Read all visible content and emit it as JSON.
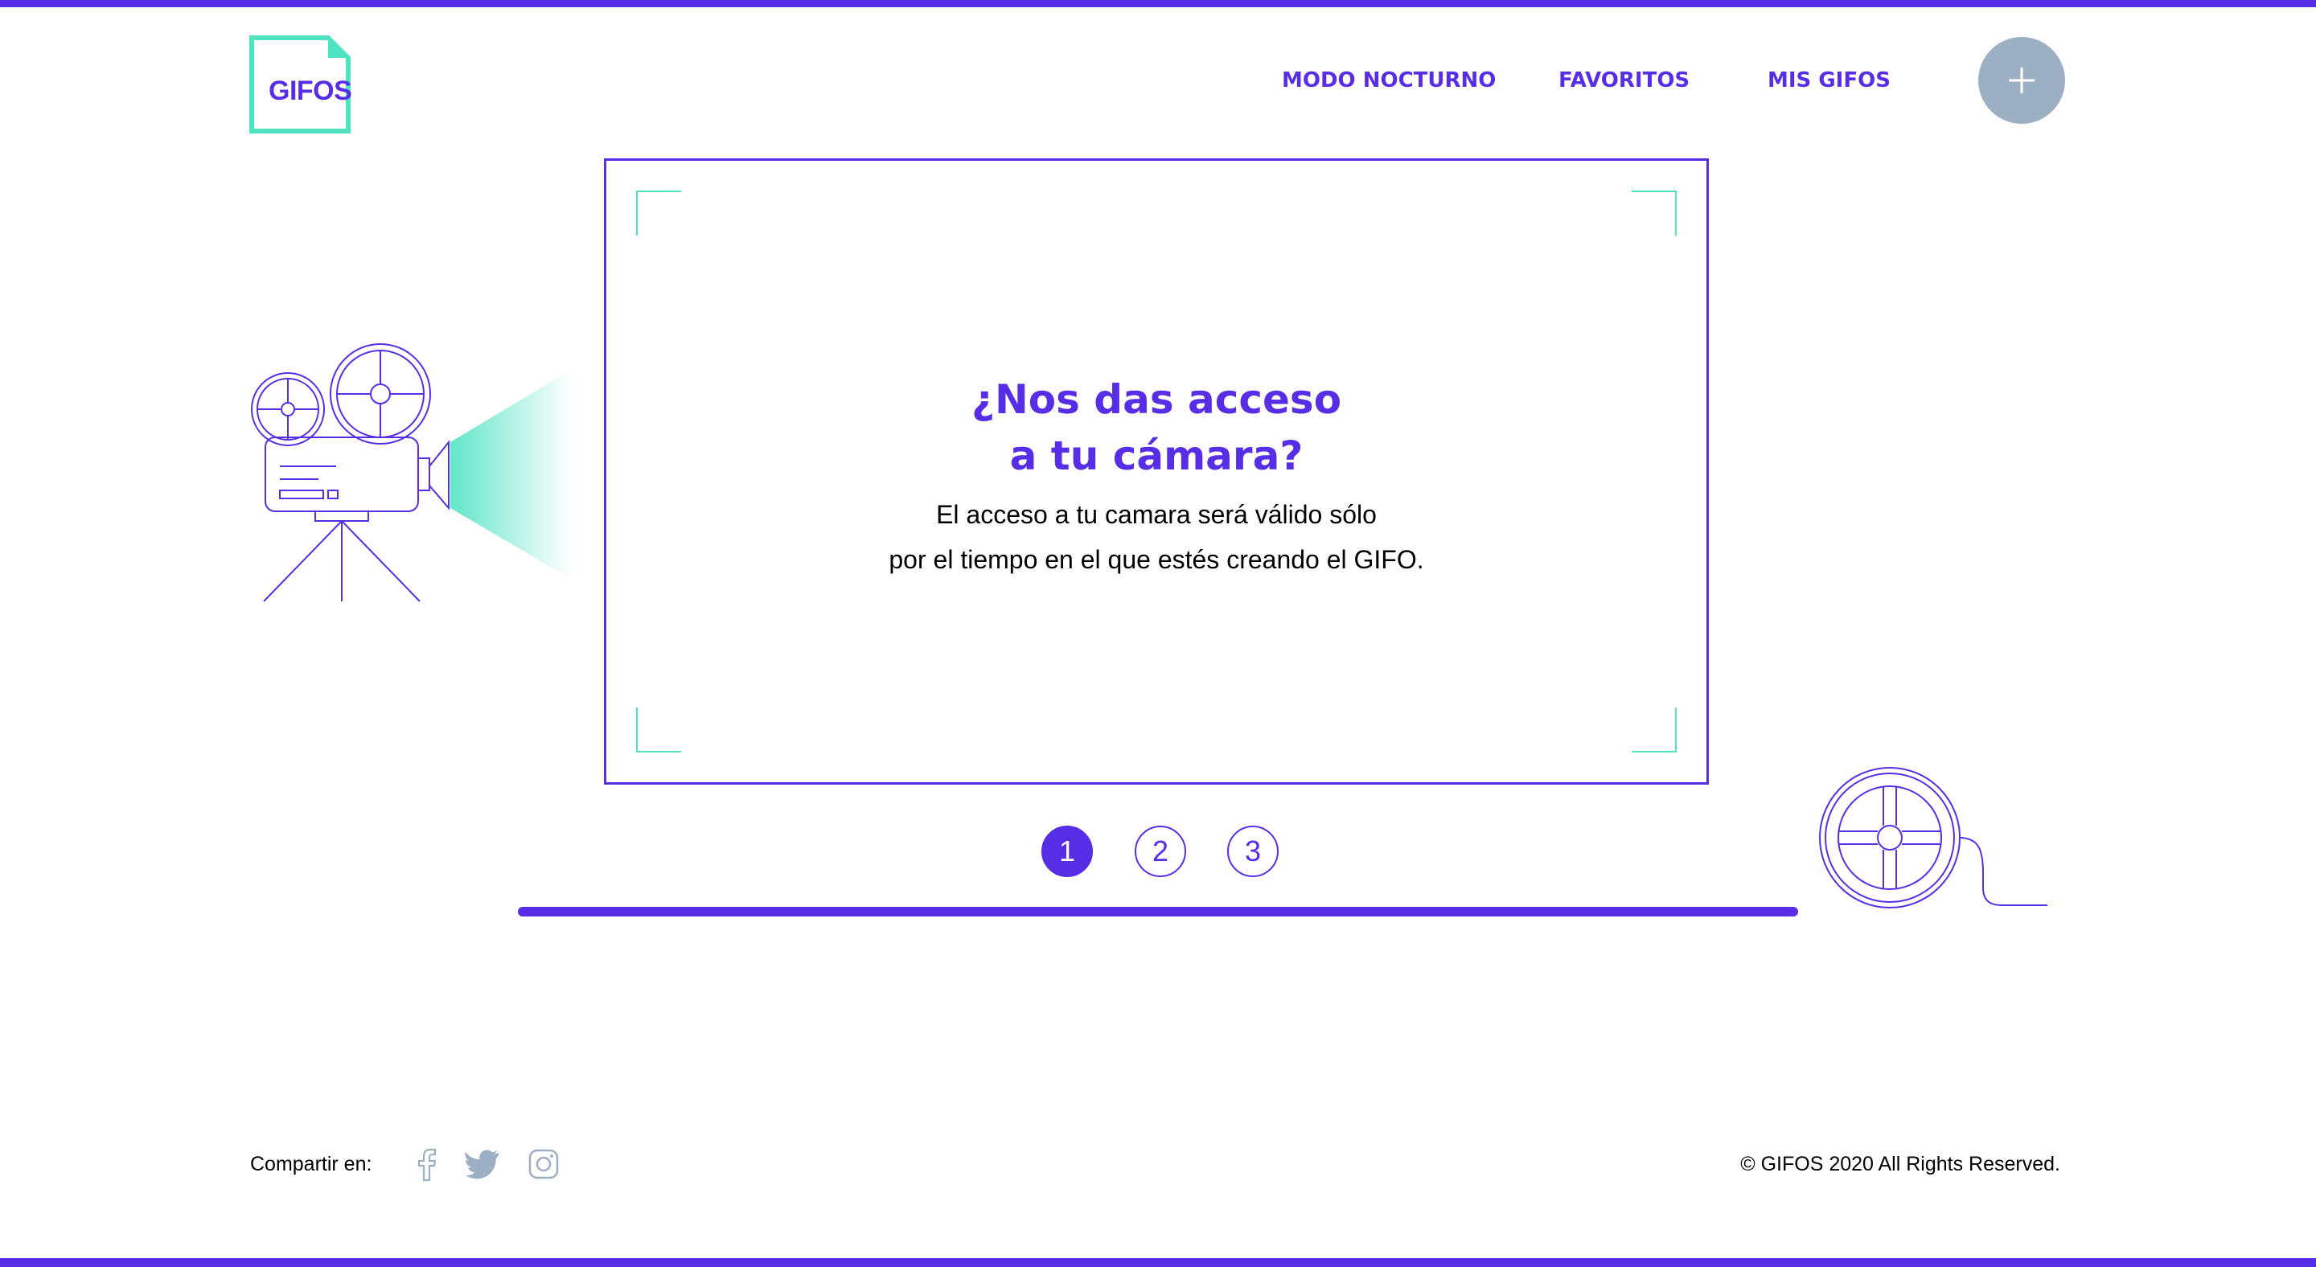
{
  "header": {
    "logo_text": "GIFOS",
    "nav": [
      "MODO NOCTURNO",
      "FAVORITOS",
      "MIS GIFOS"
    ],
    "create_button_icon": "plus-icon"
  },
  "main": {
    "title_line1": "¿Nos das acceso",
    "title_line2": "a tu cámara?",
    "text_line1": "El acceso a tu camara será válido sólo",
    "text_line2": "por el tiempo en el que estés creando el GIFO.",
    "steps": [
      "1",
      "2",
      "3"
    ],
    "active_step": 1
  },
  "footer": {
    "share_label": "Compartir en:",
    "social_icons": [
      "facebook-icon",
      "twitter-icon",
      "instagram-icon"
    ],
    "copyright": "© GIFOS 2020 All Rights Reserved."
  },
  "colors": {
    "primary": "#572EE5",
    "accent": "#50E3C2",
    "button_gray": "#9CAFC3",
    "social_gray": "#9CAFC3"
  }
}
